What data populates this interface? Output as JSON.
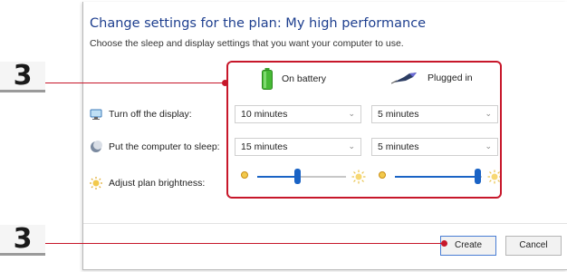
{
  "page": {
    "title": "Change settings for the plan: My high performance",
    "subtitle": "Choose the sleep and display settings that you want your computer to use."
  },
  "columns": {
    "battery_label": "On battery",
    "plugged_label": "Plugged in"
  },
  "rows": [
    {
      "label": "Turn off the display:",
      "icon": "monitor-icon",
      "battery_value": "10 minutes",
      "plugged_value": "5 minutes"
    },
    {
      "label": "Put the computer to sleep:",
      "icon": "moon-icon",
      "battery_value": "15 minutes",
      "plugged_value": "5 minutes"
    },
    {
      "label": "Adjust plan brightness:",
      "icon": "sun-icon"
    }
  ],
  "brightness": {
    "battery_level": 0.45,
    "plugged_level": 0.95
  },
  "buttons": {
    "create_label": "Create",
    "cancel_label": "Cancel"
  },
  "callouts": [
    {
      "number": "3"
    },
    {
      "number": "3"
    }
  ],
  "colors": {
    "title_blue": "#1e3f8f",
    "accent_blue": "#1a63c5",
    "callout_red": "#c7172a"
  }
}
